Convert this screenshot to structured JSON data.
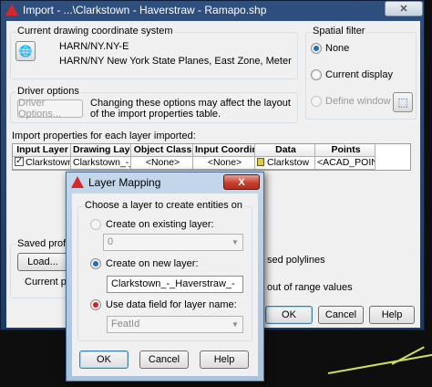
{
  "import_dialog": {
    "title": "Import - ...\\Clarkstown - Haverstraw - Ramapo.shp",
    "coord_system": {
      "group_label": "Current drawing coordinate system",
      "code": "HARN/NY.NY-E",
      "description": "HARN/NY New York State Planes, East Zone, Meter"
    },
    "spatial_filter": {
      "group_label": "Spatial filter",
      "options": [
        "None",
        "Current display",
        "Define window"
      ]
    },
    "driver_options": {
      "group_label": "Driver options",
      "button_label": "Driver Options...",
      "note": "Changing these options may affect the layout of the import properties table."
    },
    "import_properties_label": "Import properties for each layer imported:",
    "table": {
      "columns": [
        "Input Layer",
        "Drawing Layer",
        "Object Class",
        "Input Coordina",
        "Data",
        "Points"
      ],
      "rows": [
        [
          "Clarkstown",
          "Clarkstown_-_",
          "<None>",
          "<None>",
          "Clarkstow",
          "<ACAD_POINT>"
        ]
      ]
    },
    "saved_profiles": {
      "group_label": "Saved profiles",
      "load_button": "Load...",
      "current_profile_label": "Current profil"
    },
    "right_partial_text": {
      "polylines": "sed polylines",
      "range": "out of range values"
    },
    "buttons": {
      "ok": "OK",
      "cancel": "Cancel",
      "help": "Help"
    }
  },
  "layer_dialog": {
    "title": "Layer Mapping",
    "close_label": "X",
    "group_label": "Choose a layer to create entities on",
    "option_existing": "Create on existing layer:",
    "existing_value": "0",
    "option_new": "Create on new layer:",
    "new_value": "Clarkstown_-_Haverstraw_-",
    "option_data_field": "Use data field for layer name:",
    "data_field_value": "FeatId",
    "buttons": {
      "ok": "OK",
      "cancel": "Cancel",
      "help": "Help"
    }
  }
}
